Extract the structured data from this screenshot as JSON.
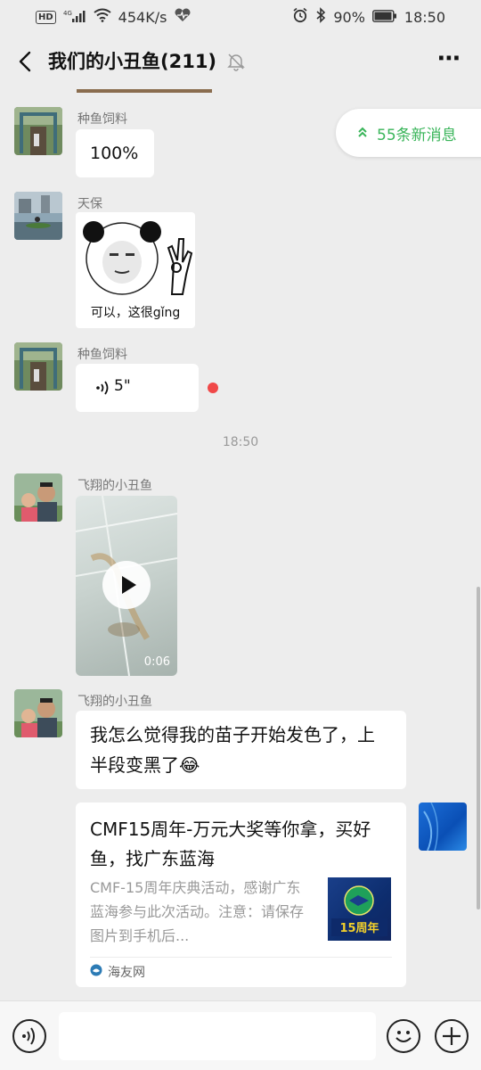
{
  "statusbar": {
    "hd": "HD",
    "signal": "4G",
    "speed": "454K/s",
    "battery": "90%",
    "time": "18:50"
  },
  "header": {
    "title": "我们的小丑鱼(211)",
    "more": "⋯"
  },
  "new_messages": "55条新消息",
  "messages": [
    {
      "sender": "种鱼饲料",
      "text": "100%"
    },
    {
      "sender": "天保",
      "sticker_caption": "可以，这很gǐng"
    },
    {
      "sender": "种鱼饲料",
      "voice_duration": "5\""
    },
    {
      "timestamp": "18:50"
    },
    {
      "sender": "飞翔的小丑鱼",
      "video_duration": "0:06"
    },
    {
      "sender": "飞翔的小丑鱼",
      "text": "我怎么觉得我的苗子开始发色了，上半段变黑了😂"
    }
  ],
  "card": {
    "title": "CMF15周年-万元大奖等你拿，买好鱼，找广东蓝海",
    "desc": "CMF-15周年庆典活动，感谢广东蓝海参与此次活动。注意：请保存图片到手机后...",
    "thumb_text": "15周年",
    "source": "海友网"
  }
}
